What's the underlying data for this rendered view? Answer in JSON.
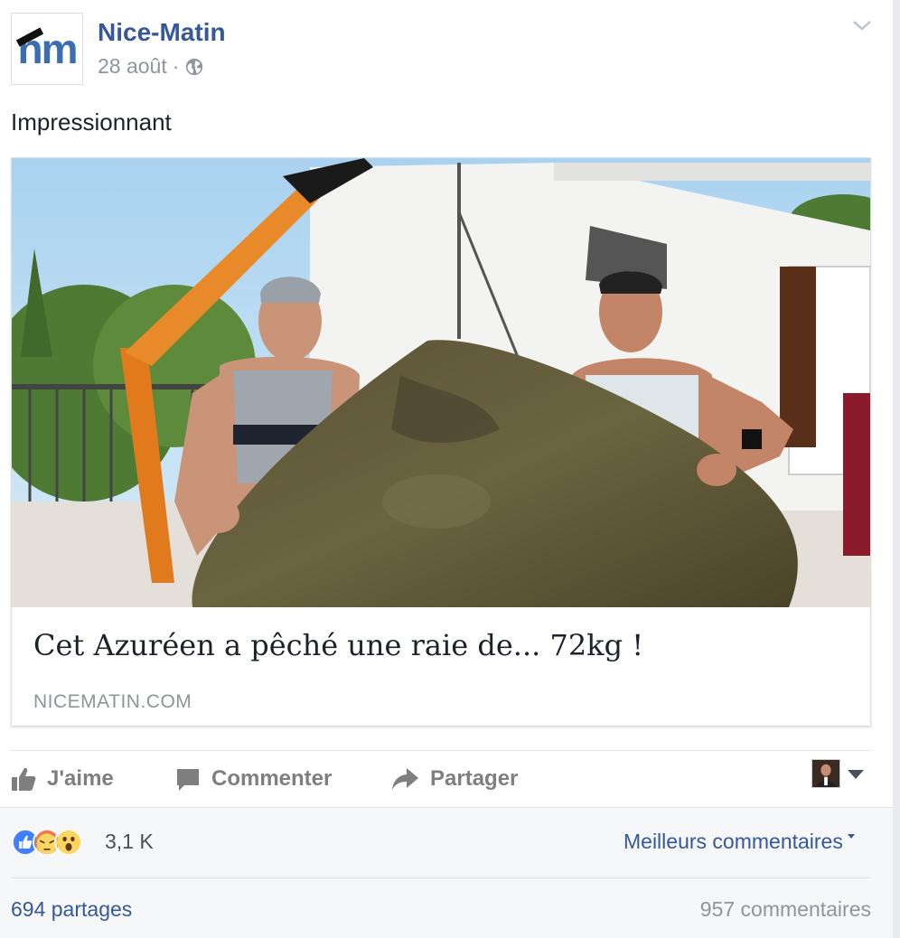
{
  "page": {
    "name": "Nice-Matin",
    "logo_text": "nm",
    "date": "28 août",
    "date_separator": "·",
    "privacy_icon": "globe-icon",
    "menu_icon": "chevron-down-icon"
  },
  "post": {
    "text": "Impressionnant"
  },
  "link_card": {
    "image_alt_icon": "photo-two-men-holding-stingray",
    "title": "Cet Azuréen a pêché une raie de... 72kg !",
    "domain": "NICEMATIN.COM"
  },
  "actions": {
    "like": "J'aime",
    "comment": "Commenter",
    "share": "Partager",
    "like_icon": "thumbs-up-icon",
    "comment_icon": "comment-bubble-icon",
    "share_icon": "share-arrow-icon",
    "viewer_icon": "user-avatar",
    "audience_icon": "caret-down-icon"
  },
  "stats": {
    "reactions": [
      "like",
      "angry",
      "wow"
    ],
    "reaction_count": "3,1 K",
    "sort_label": "Meilleurs commentaires",
    "shares": "694 partages",
    "comments": "957 commentaires"
  },
  "colors": {
    "link_blue": "#365899",
    "muted_gray": "#90949c",
    "action_gray": "#7f7f7f",
    "like_blue": "#4080ff",
    "angry_orange": "#f7714c",
    "wow_yellow": "#fcd660"
  }
}
